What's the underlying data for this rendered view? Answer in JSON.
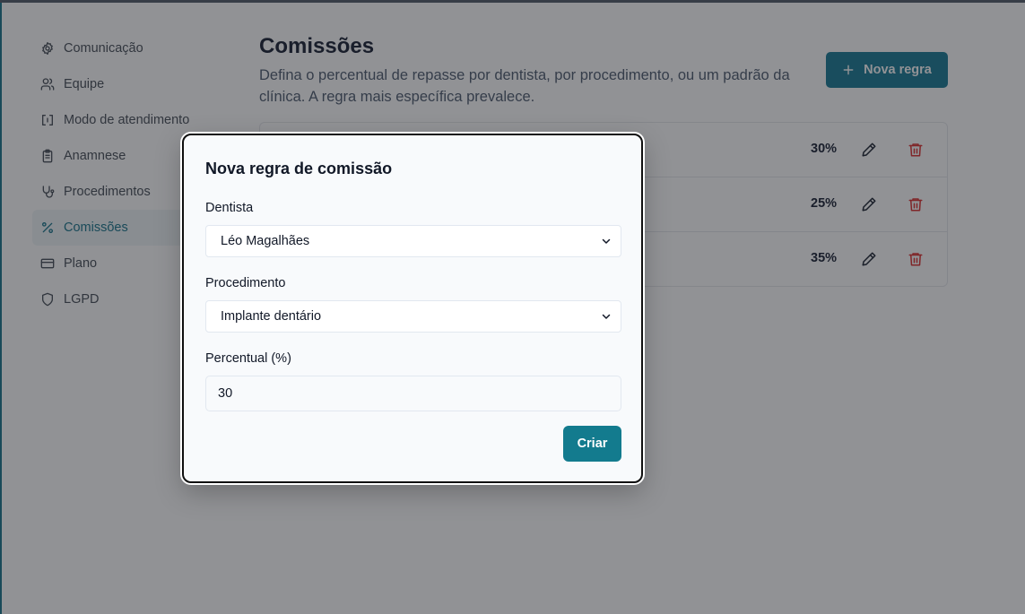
{
  "sidebar": {
    "items": [
      {
        "label": "Comunicação",
        "icon": "gear-icon",
        "active": false
      },
      {
        "label": "Equipe",
        "icon": "users-icon",
        "active": false
      },
      {
        "label": "Modo de atendimento",
        "icon": "brackets-icon",
        "active": false
      },
      {
        "label": "Anamnese",
        "icon": "clipboard-icon",
        "active": false
      },
      {
        "label": "Procedimentos",
        "icon": "stethoscope-icon",
        "active": false
      },
      {
        "label": "Comissões",
        "icon": "percent-icon",
        "active": true
      },
      {
        "label": "Plano",
        "icon": "credit-card-icon",
        "active": false
      },
      {
        "label": "LGPD",
        "icon": "shield-icon",
        "active": false
      }
    ]
  },
  "main": {
    "title": "Comissões",
    "description": "Defina o percentual de repasse por dentista, por procedimento, ou um padrão da clínica. A regra mais específica prevalece.",
    "new_rule_label": "Nova regra",
    "rules": [
      {
        "percent": "30%"
      },
      {
        "percent": "25%"
      },
      {
        "percent": "35%"
      }
    ]
  },
  "modal": {
    "title": "Nova regra de comissão",
    "dentist_label": "Dentista",
    "dentist_value": "Léo Magalhães",
    "procedure_label": "Procedimento",
    "procedure_value": "Implante dentário",
    "percent_label": "Percentual (%)",
    "percent_value": "30",
    "submit_label": "Criar"
  },
  "colors": {
    "accent": "#0e7490",
    "danger": "#dc2626"
  }
}
